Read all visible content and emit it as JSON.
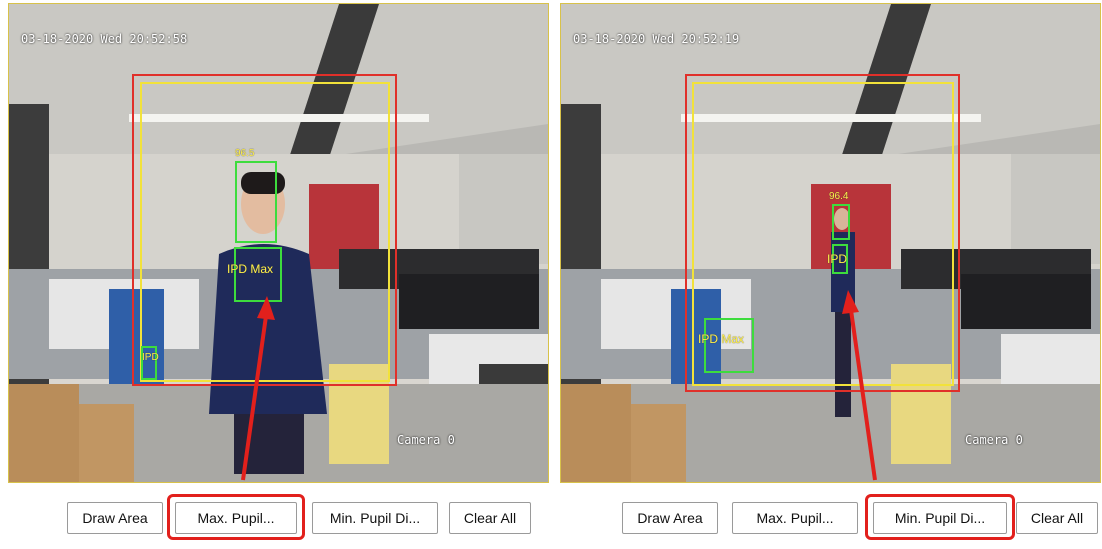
{
  "left_view": {
    "timestamp": "03-18-2020 Wed 20:52:58",
    "camera_label": "Camera 0",
    "face_score": "96.5",
    "ipd_max_label": "IPD Max",
    "ipd_label": "IPD"
  },
  "right_view": {
    "timestamp": "03-18-2020 Wed 20:52:19",
    "camera_label": "Camera 0",
    "face_score": "96.4",
    "ipd_max_label": "IPD Max",
    "ipd_label": "IPD"
  },
  "left_buttons": {
    "draw_area": "Draw Area",
    "max_pupil": "Max. Pupil...",
    "min_pupil": "Min. Pupil Di...",
    "clear_all": "Clear All"
  },
  "right_buttons": {
    "draw_area": "Draw Area",
    "max_pupil": "Max. Pupil...",
    "min_pupil": "Min. Pupil Di...",
    "clear_all": "Clear All"
  },
  "colors": {
    "detection_region": "#e0302a",
    "inner_region": "#f2e23a",
    "face_box": "#3ddc3d",
    "highlight": "#e2201c",
    "label_text": "#fff04a"
  }
}
